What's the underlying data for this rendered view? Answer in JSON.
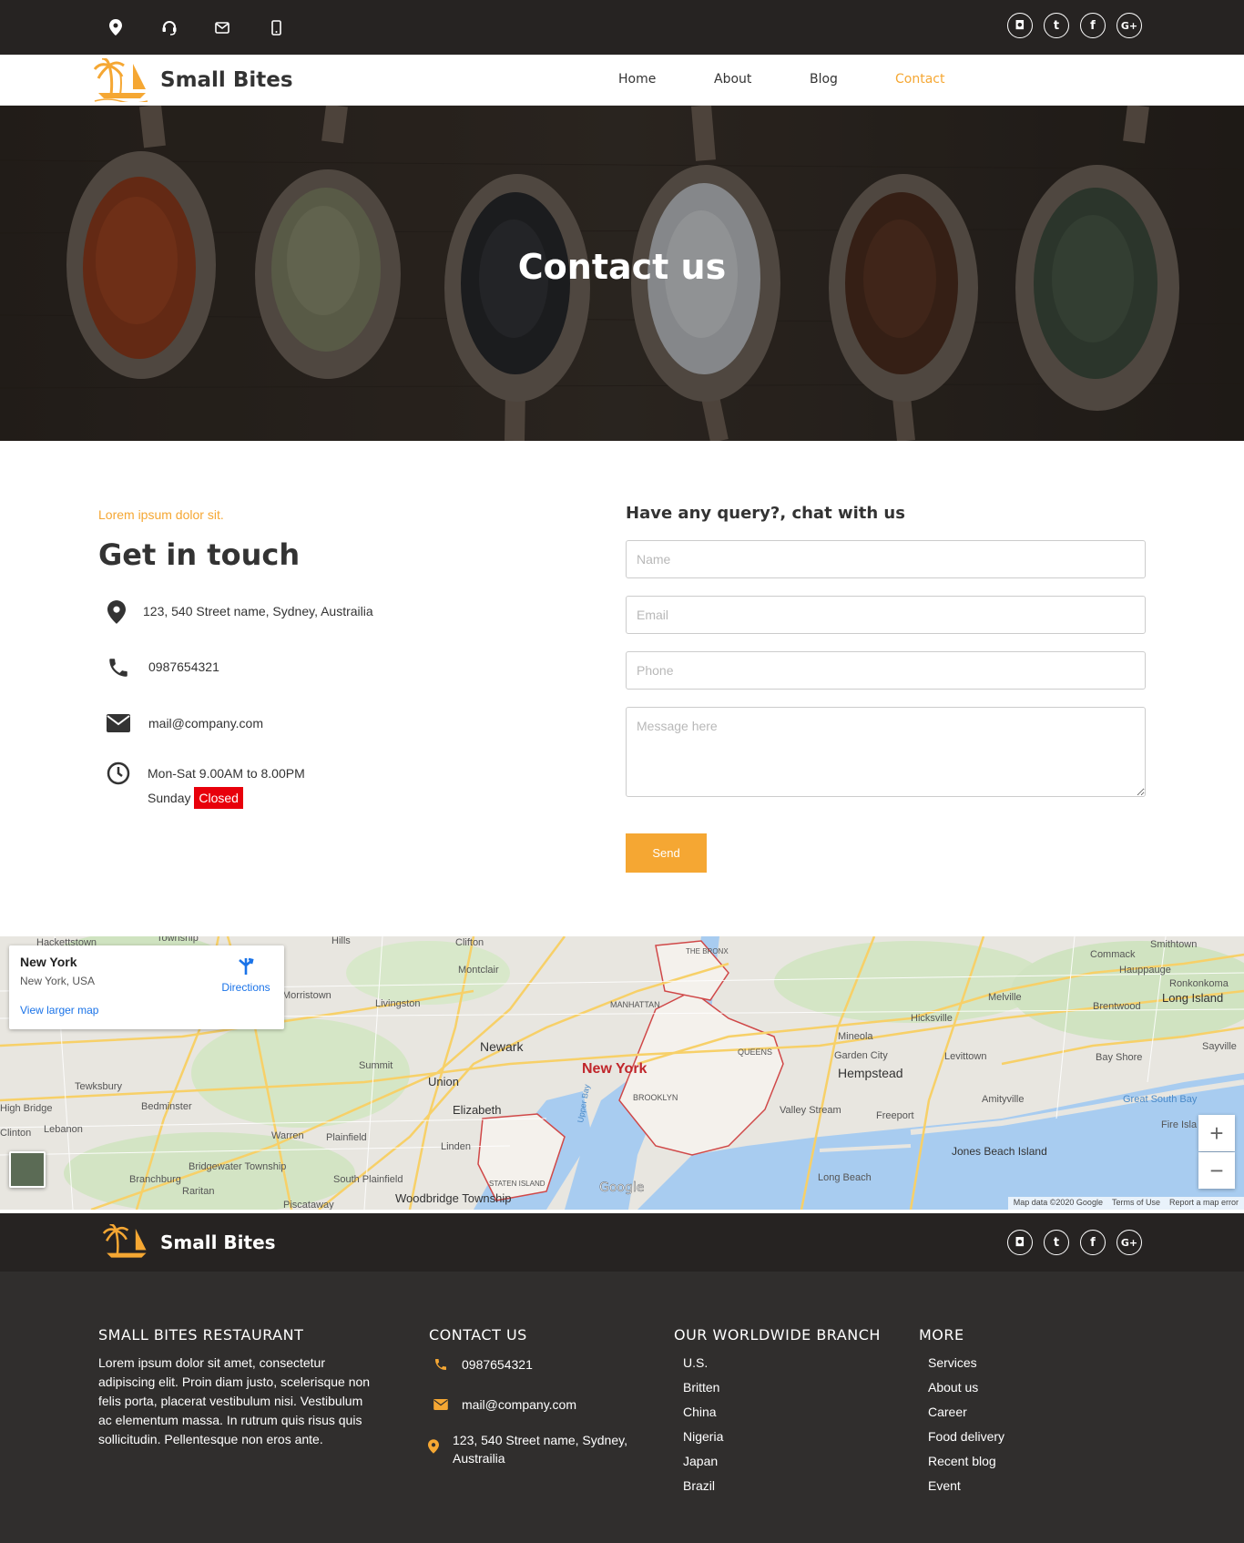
{
  "brand": {
    "name": "Small Bites",
    "accent": "#f5a733",
    "dark": "#262322"
  },
  "nav": {
    "items": [
      "Home",
      "About",
      "Blog",
      "Contact"
    ],
    "active": "Contact"
  },
  "hero": {
    "title": "Contact us"
  },
  "contact": {
    "kicker": "Lorem ipsum dolor sit.",
    "heading": "Get in touch",
    "address": "123, 540 Street name, Sydney, Austrailia",
    "phone": "0987654321",
    "email": "mail@company.com",
    "hours": "Mon-Sat 9.00AM to 8.00PM",
    "sunday_label": "Sunday",
    "sunday_status": "Closed"
  },
  "form": {
    "title": "Have any query?, chat with us",
    "name_placeholder": "Name",
    "email_placeholder": "Email",
    "phone_placeholder": "Phone",
    "message_placeholder": "Message here",
    "send_label": "Send"
  },
  "map": {
    "place_title": "New York",
    "place_subtitle": "New York, USA",
    "directions_label": "Directions",
    "larger_map_label": "View larger map",
    "attribution": [
      "Map data ©2020 Google",
      "Terms of Use",
      "Report a map error"
    ],
    "labels": [
      "New York",
      "Newark",
      "MANHATTAN",
      "BROOKLYN",
      "QUEENS",
      "THE BRONX",
      "STATEN ISLAND",
      "Hempstead",
      "Long Island",
      "Elizabeth",
      "Union",
      "Montclair",
      "Clifton",
      "Jones Beach Island",
      "Freeport",
      "Long Beach",
      "Great South Bay",
      "Bay Shore",
      "Brentwood",
      "Hauppauge",
      "Levittown",
      "Hicksville",
      "Valley Stream",
      "Livingston",
      "Summit",
      "Plainfield",
      "Bridgewater Township",
      "Linden",
      "Woodbridge Township",
      "Smithtown",
      "Commack",
      "Melville",
      "Ronkonkoma",
      "Amityville",
      "Mineola",
      "Garden City",
      "Tewksbury",
      "Bedminster",
      "Warren",
      "Branchburg",
      "Raritan",
      "South Plainfield",
      "Piscataway",
      "High Bridge",
      "Lebanon",
      "Clinton",
      "Sayville",
      "Fire Isla",
      "Upper Bay",
      "Morristown",
      "Hills",
      "Hackettstown",
      "Township"
    ]
  },
  "footer": {
    "brand_name": "Small Bites",
    "about": {
      "heading": "SMALL BITES RESTAURANT",
      "text": "Lorem ipsum dolor sit amet, consectetur adipiscing elit. Proin diam justo, scelerisque non felis porta, placerat vestibulum nisi. Vestibulum ac elementum massa. In rutrum quis risus quis sollicitudin. Pellentesque non eros ante."
    },
    "contact": {
      "heading": "CONTACT US",
      "phone": "0987654321",
      "email": "mail@company.com",
      "address_line1": "123, 540 Street name, Sydney,",
      "address_line2": "Austrailia"
    },
    "branches": {
      "heading": "OUR WORLDWIDE BRANCH",
      "items": [
        "U.S.",
        "Britten",
        "China",
        "Nigeria",
        "Japan",
        "Brazil"
      ]
    },
    "more": {
      "heading": "MORE",
      "items": [
        "Services",
        "About us",
        "Career",
        "Food delivery",
        "Recent blog",
        "Event"
      ]
    }
  },
  "icons": {
    "topbar": [
      "location-pin-icon",
      "headset-icon",
      "envelope-icon",
      "mobile-phone-icon"
    ],
    "social": [
      "instagram-icon",
      "twitter-icon",
      "facebook-icon",
      "google-plus-icon"
    ],
    "social_glyphs": [
      "◘",
      "t",
      "f",
      "G+"
    ]
  }
}
